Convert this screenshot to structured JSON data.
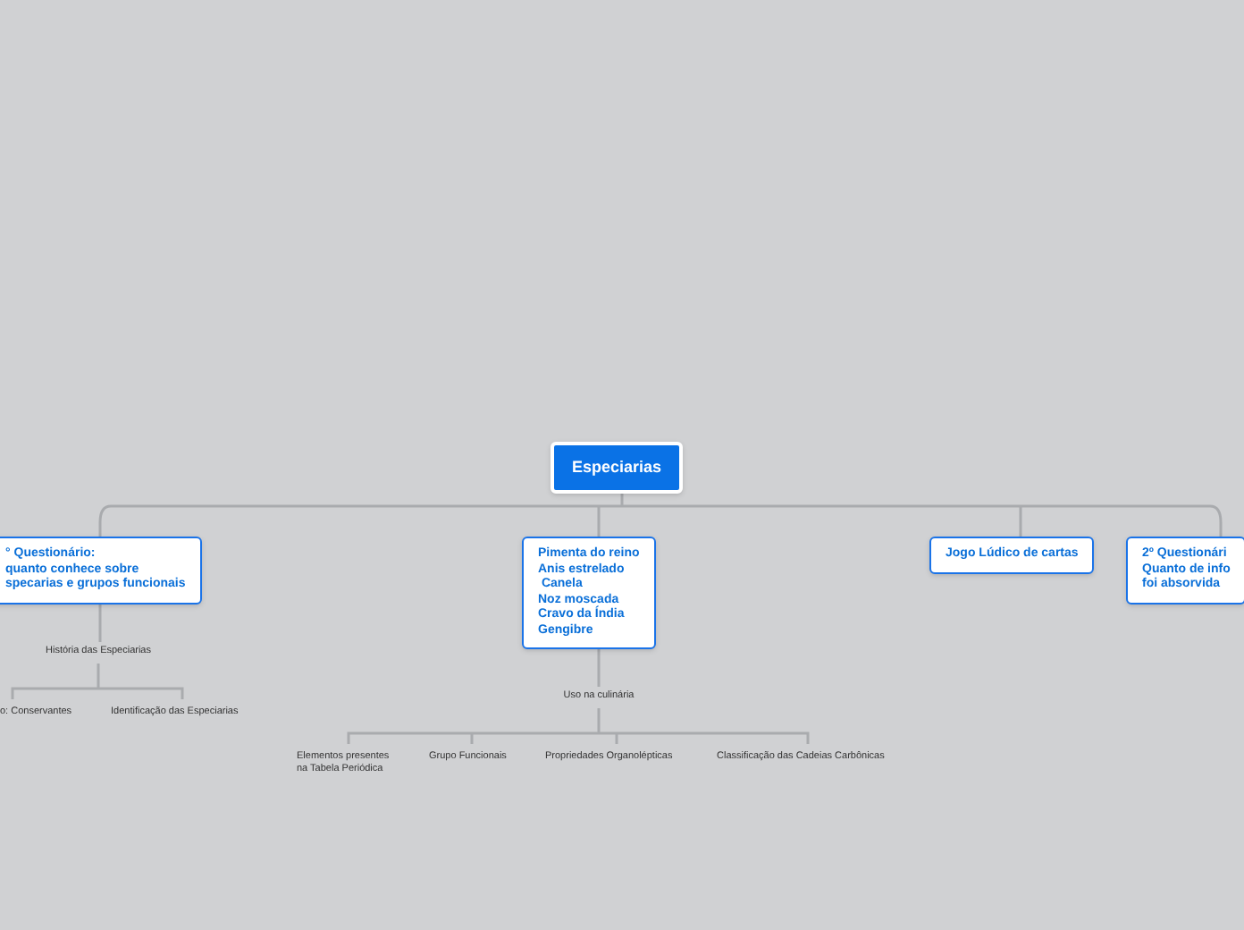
{
  "root": {
    "label": "Especiarias",
    "children": [
      {
        "lines": [
          "° Questionário:",
          "quanto conhece sobre",
          "specarias e grupos funcionais"
        ],
        "children": [
          {
            "lines": [
              "História das Especiarias"
            ],
            "children": [
              {
                "lines": [
                  "o: Conservantes"
                ]
              },
              {
                "lines": [
                  "Identificação das Especiarias"
                ]
              }
            ]
          }
        ]
      },
      {
        "lines": [
          "Pimenta do reino",
          "Anis estrelado",
          " Canela",
          "Noz moscada",
          "Cravo da Índia",
          "Gengibre"
        ],
        "children": [
          {
            "lines": [
              "Uso na culinária"
            ],
            "children": [
              {
                "lines": [
                  "Elementos presentes",
                  "na Tabela Periódica"
                ]
              },
              {
                "lines": [
                  "Grupo Funcionais"
                ]
              },
              {
                "lines": [
                  "Propriedades Organolépticas"
                ]
              },
              {
                "lines": [
                  "Classificação das Cadeias Carbônicas"
                ]
              }
            ]
          }
        ]
      },
      {
        "lines": [
          "Jogo Lúdico de cartas"
        ]
      },
      {
        "lines": [
          "2º Questionári",
          "Quanto de info",
          "foi absorvida"
        ]
      }
    ]
  }
}
